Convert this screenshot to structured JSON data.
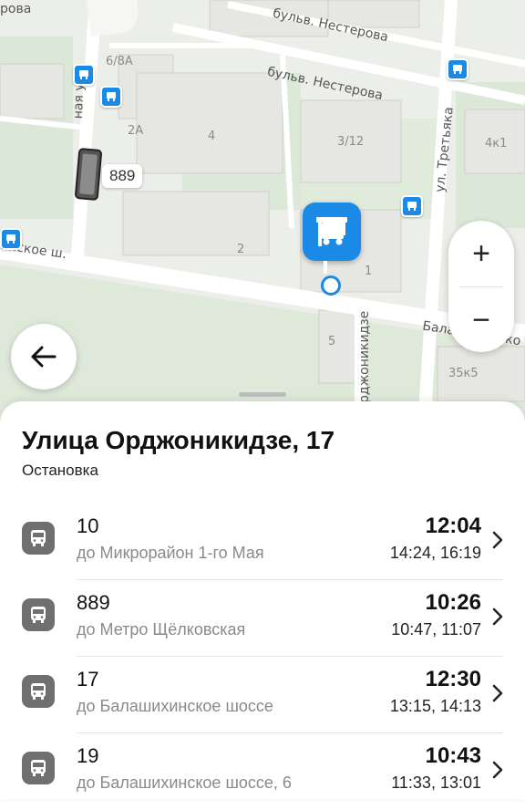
{
  "map": {
    "streets": {
      "top_left": "ровa",
      "nesterova_1": "бульв. Нестерова",
      "nesterova_2": "бульв. Нестерова",
      "left_vertical": "ная ул.",
      "tretyaka": "ул. Третьяка",
      "shosse_left": "инское ш.",
      "ordzhonikidze": "рджоникидзе",
      "bala_right": "Балашихинско"
    },
    "houses": {
      "h6_8a": "6/8А",
      "h2a": "2А",
      "h4": "4",
      "h3_12": "3/12",
      "h4k1": "4к1",
      "h2": "2",
      "h1": "1",
      "h5": "5",
      "h35k5": "35к5"
    },
    "vehicle_route": "889"
  },
  "controls": {
    "zoom_in": "+",
    "zoom_out": "−",
    "back_icon": "arrow-left-icon"
  },
  "stop": {
    "title": "Улица Орджоникидзе, 17",
    "type": "Остановка"
  },
  "routes": [
    {
      "number": "10",
      "destination": "до Микрорайон 1-го Мая",
      "next": "12:04",
      "later": "14:24, 16:19"
    },
    {
      "number": "889",
      "destination": "до Метро Щёлковская",
      "next": "10:26",
      "later": "10:47, 11:07"
    },
    {
      "number": "17",
      "destination": "до Балашихинское шоссе",
      "next": "12:30",
      "later": "13:15, 14:13"
    },
    {
      "number": "19",
      "destination": "до Балашихинское шоссе, 6",
      "next": "10:43",
      "later": "11:33, 13:01"
    }
  ],
  "colors": {
    "accent": "#1a8ae6",
    "park": "#d7e6d3",
    "road": "#ffffff",
    "block": "#e4e4e0"
  }
}
